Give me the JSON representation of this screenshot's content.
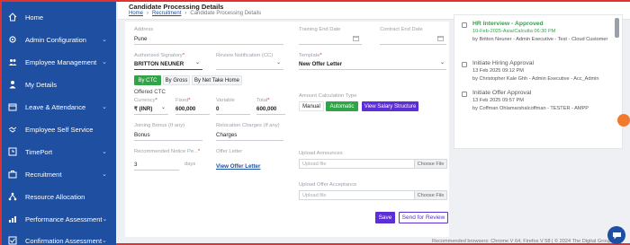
{
  "sidebar": {
    "items": [
      {
        "label": "Home",
        "icon": "home-icon",
        "chev": ""
      },
      {
        "label": "Admin Configuration",
        "icon": "gear-icon",
        "chev": "⌄"
      },
      {
        "label": "Employee Management",
        "icon": "people-icon",
        "chev": "⌄"
      },
      {
        "label": "My Details",
        "icon": "person-icon",
        "chev": ""
      },
      {
        "label": "Leave & Attendance",
        "icon": "calendar-icon",
        "chev": "⌄"
      },
      {
        "label": "Employee Self Service",
        "icon": "handshake-icon",
        "chev": ""
      },
      {
        "label": "TimePort",
        "icon": "clock-icon",
        "chev": "⌄"
      },
      {
        "label": "Recruitment",
        "icon": "briefcase-icon",
        "chev": "⌄"
      },
      {
        "label": "Resource Allocation",
        "icon": "network-icon",
        "chev": ""
      },
      {
        "label": "Performance Assessment",
        "icon": "chart-icon",
        "chev": "⌄"
      },
      {
        "label": "Confirmation Assessment",
        "icon": "check-icon",
        "chev": "⌄"
      }
    ]
  },
  "header": {
    "title": "Candidate Processing Details",
    "breadcrumb": [
      "Home",
      "Recruitment",
      "Candidate Processing Details"
    ]
  },
  "form": {
    "address_label": "Address",
    "address_value": "Pune",
    "training_end_label": "Training End Date",
    "contract_end_label": "Contract End Date",
    "signatory_label": "Authorized Signatory",
    "signatory_value": "BRITTON NEUNER",
    "review_notif_label": "Review Notification (CC)",
    "template_label": "Template",
    "template_value": "New Offer Letter",
    "ctc_modes": [
      "By CTC",
      "By Gross",
      "By Net Take Home"
    ],
    "offered_ctc_label": "Offered CTC",
    "currency_label": "Currency",
    "currency_value": "₹ (INR)",
    "fixed_label": "Fixed",
    "fixed_value": "600,000",
    "variable_label": "Variable",
    "variable_value": "0",
    "total_label": "Total",
    "total_value": "600,000",
    "amount_calc_label": "Amount Calculation Type",
    "calc_modes": [
      "Manual",
      "Automatic"
    ],
    "view_salary_label": "View Salary Structure",
    "joining_bonus_label": "Joining Bonus (If any)",
    "joining_bonus_value": "Bonus",
    "relocation_label": "Relocation Charges (If any)",
    "relocation_value": "Charges",
    "notice_label": "Recommended Notice Pe...",
    "notice_value": "3",
    "notice_unit": "days",
    "offer_letter_label": "Offer Letter",
    "view_offer_label": "View Offer Letter",
    "upload_announce_label": "Upload Announces",
    "upload_acceptance_label": "Upload Offer Acceptance",
    "upload_placeholder": "Upload file",
    "choose_file": "Choose File",
    "save_label": "Save",
    "review_label": "Send for Review"
  },
  "timeline": [
    {
      "title": "HR Interview - Approved",
      "date": "10-Feb-2025-Asia/Calcutta   06:30 PM",
      "by": "by Britton Neuner - Admin Executive - Test - Cloud Customer",
      "status_color": "#2fa548"
    },
    {
      "title": "Initiate Hiring Approval",
      "date": "13 Feb 2025   09:12 PM",
      "by": "by Christopher Kale Ghh - Admin Executive - Acc_Admin",
      "status_color": "#777777"
    },
    {
      "title": "Initiate Offer Approval",
      "date": "13 Feb 2025   09:57 PM",
      "by": "by Coffman Ohlamarshalcoffman - TESTER - AMPP",
      "status_color": "#777777"
    }
  ],
  "footer": {
    "text": "Recommended browsers: Chrome V 64, Firefox V 58  |  © 2024 The Digital Group Inc."
  },
  "colors": {
    "sidebar": "#1e4fa0",
    "accent": "#5b2ed6",
    "success": "#2fa548"
  }
}
